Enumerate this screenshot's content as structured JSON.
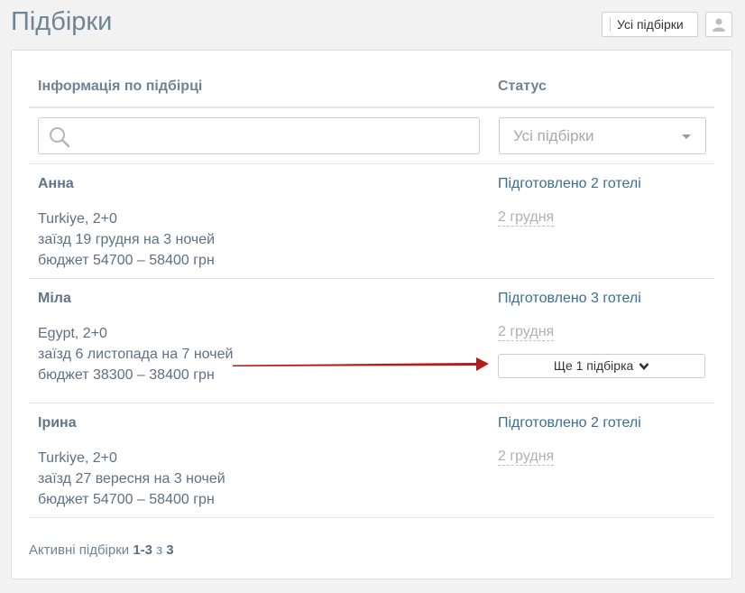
{
  "header": {
    "title": "Підбірки",
    "all_button": "Усі підбірки",
    "user_icon": "user-icon"
  },
  "table": {
    "col_info": "Інформація по підбірці",
    "col_status": "Статус",
    "search_placeholder": "",
    "status_select_value": "Усі підбірки",
    "rows": [
      {
        "name": "Анна",
        "line1": "Turkiye, 2+0",
        "line2": "заїзд 19 грудня на 3 ночей",
        "line3": "бюджет 54700 – 58400 грн",
        "status": "Підготовлено 2 готелі",
        "date": "2 грудня"
      },
      {
        "name": "Міла",
        "line1": "Egypt, 2+0",
        "line2": "заїзд 6 листопада на 7 ночей",
        "line3": "бюджет 38300 – 38400 грн",
        "status": "Підготовлено 3 готелі",
        "date": "2 грудня",
        "more": "Ще 1 підбірка"
      },
      {
        "name": "Ірина",
        "line1": "Turkiye, 2+0",
        "line2": "заїзд 27 вересня на 3 ночей",
        "line3": "бюджет 54700 – 58400 грн",
        "status": "Підготовлено 2 готелі",
        "date": "2 грудня"
      }
    ]
  },
  "footer": {
    "prefix": "Активні підбірки",
    "range": "1-3",
    "of": "з",
    "total": "3"
  },
  "colors": {
    "arrow": "#b01e1e",
    "status_link": "#3a6f91"
  }
}
